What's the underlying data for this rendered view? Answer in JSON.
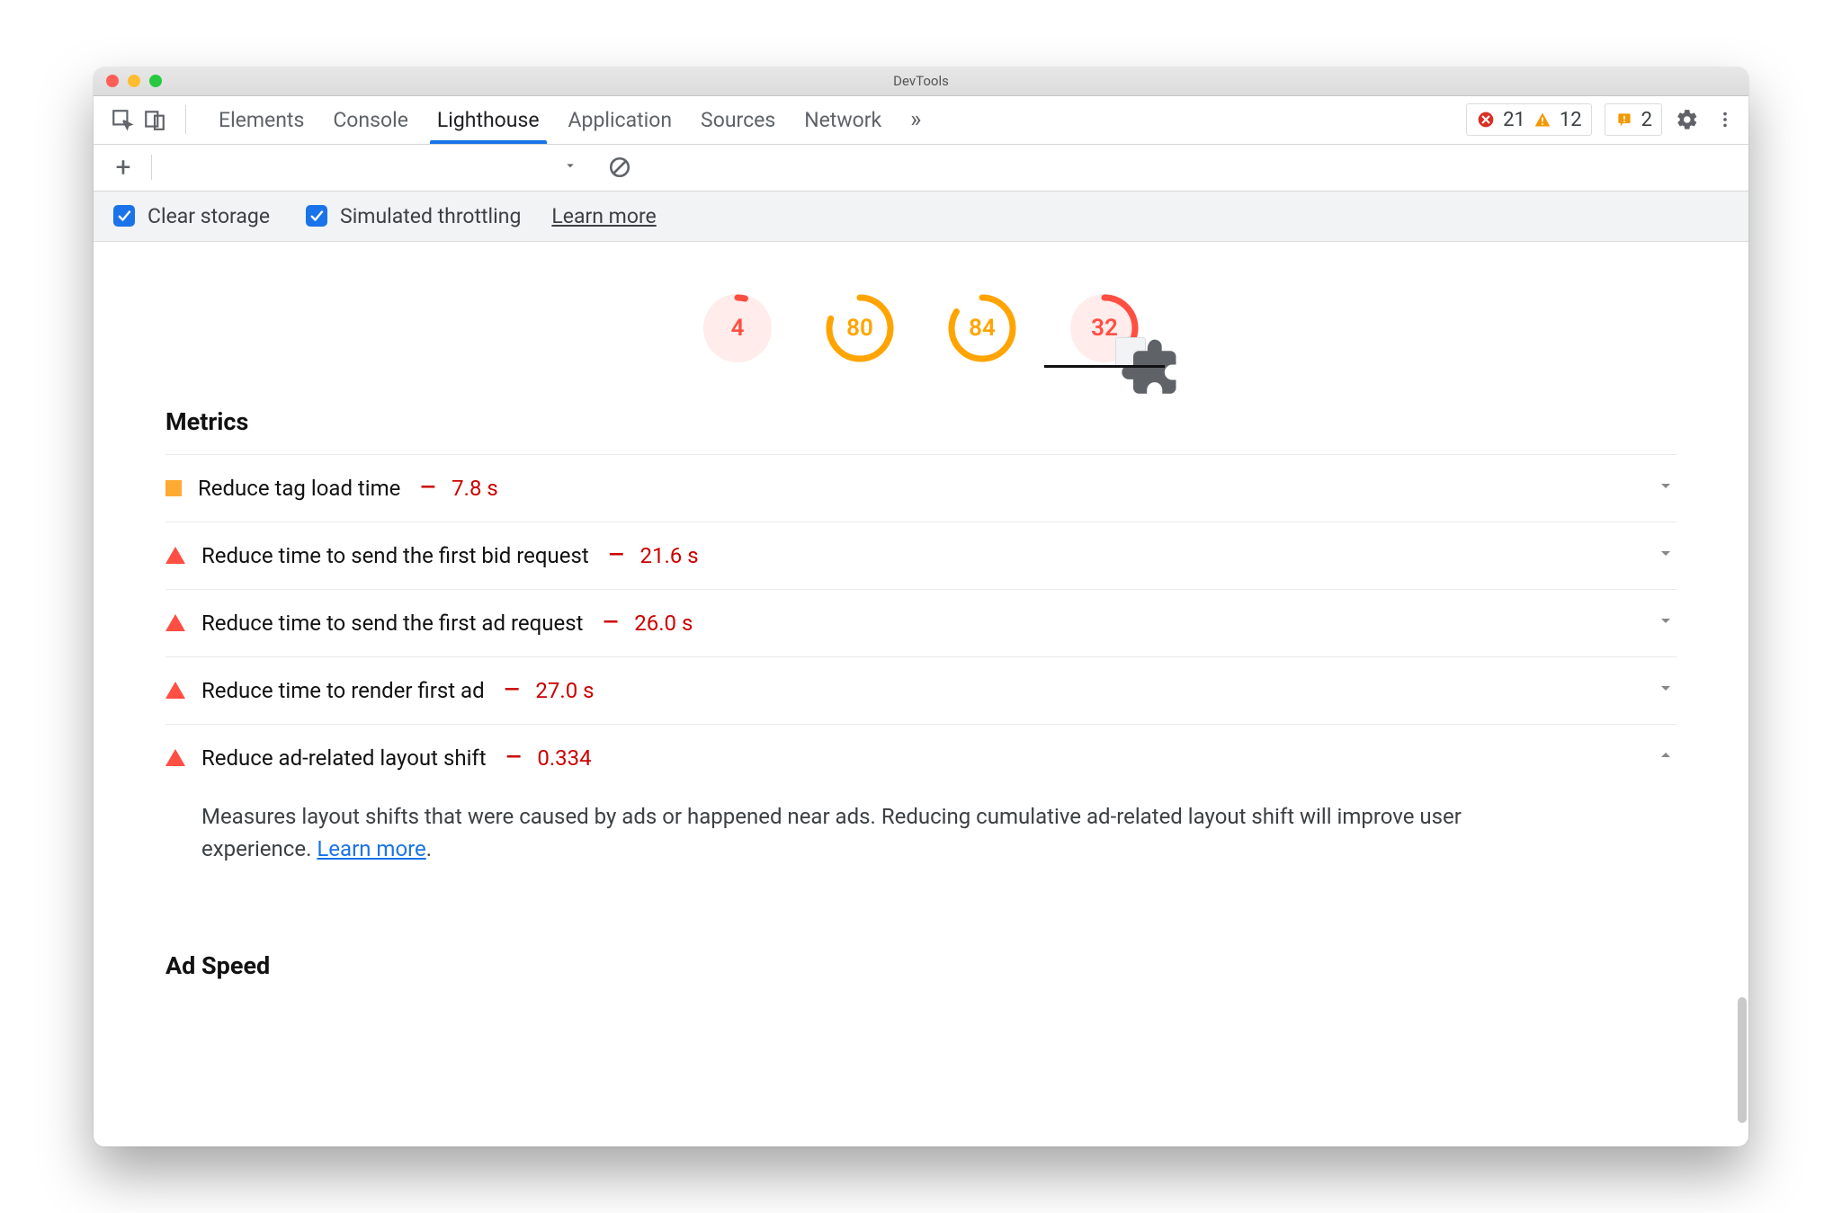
{
  "window": {
    "title": "DevTools"
  },
  "tabs": {
    "items": [
      "Elements",
      "Console",
      "Lighthouse",
      "Application",
      "Sources",
      "Network"
    ],
    "active_index": 2
  },
  "status_pills": {
    "errors": "21",
    "warnings": "12",
    "issues": "2"
  },
  "settingsrow": {
    "clear_storage_label": "Clear storage",
    "throttling_label": "Simulated throttling",
    "learn_more": "Learn more"
  },
  "gauges": [
    {
      "score": 4,
      "color": "#ff4e42",
      "fill": "#ffeceb"
    },
    {
      "score": 80,
      "color": "#ffa400",
      "fill": "#ffffff"
    },
    {
      "score": 84,
      "color": "#ffa400",
      "fill": "#ffffff"
    },
    {
      "score": 32,
      "color": "#ff4e42",
      "fill": "#ffeceb",
      "active": true,
      "plugin": true
    }
  ],
  "sections": {
    "metrics_title": "Metrics",
    "adspeed_title": "Ad Speed"
  },
  "metrics": [
    {
      "shape": "sq",
      "label": "Reduce tag load time",
      "value": "7.8 s",
      "expanded": false
    },
    {
      "shape": "tri",
      "label": "Reduce time to send the first bid request",
      "value": "21.6 s",
      "expanded": false
    },
    {
      "shape": "tri",
      "label": "Reduce time to send the first ad request",
      "value": "26.0 s",
      "expanded": false
    },
    {
      "shape": "tri",
      "label": "Reduce time to render first ad",
      "value": "27.0 s",
      "expanded": false
    },
    {
      "shape": "tri",
      "label": "Reduce ad-related layout shift",
      "value": "0.334",
      "expanded": true,
      "desc": "Measures layout shifts that were caused by ads or happened near ads. Reducing cumulative ad-related layout shift will improve user experience. ",
      "desc_link": "Learn more"
    }
  ]
}
